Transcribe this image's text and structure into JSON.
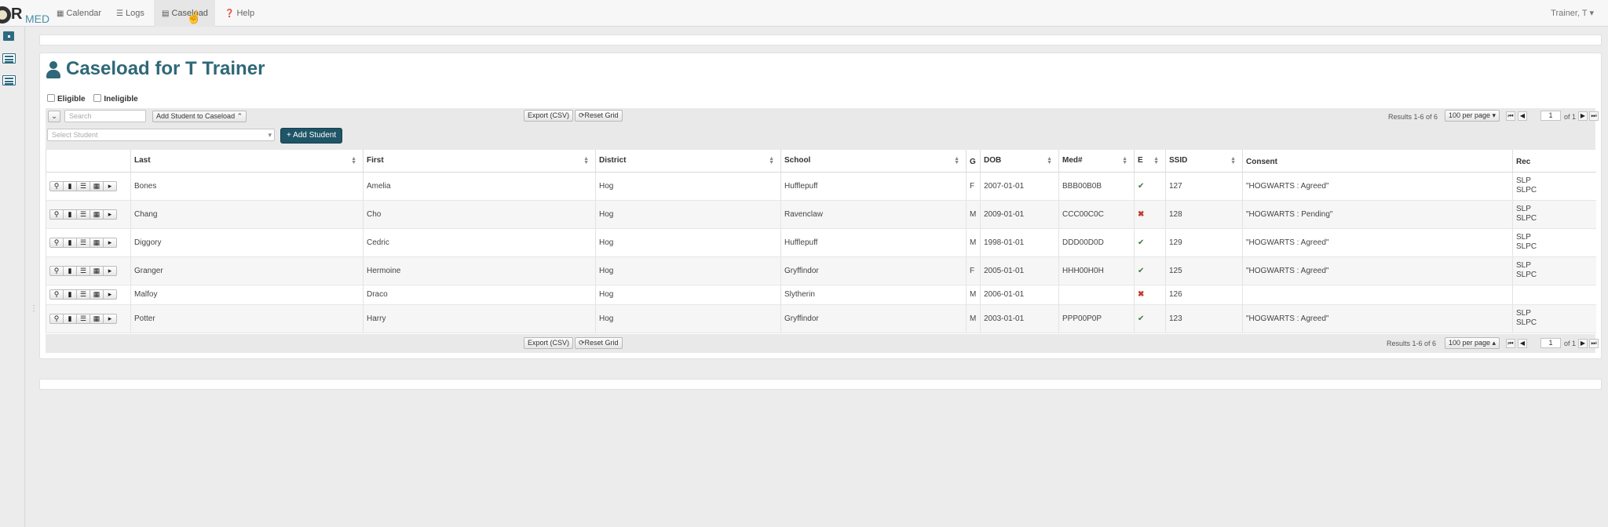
{
  "nav": {
    "logo_r": "R",
    "logo_med": "MED",
    "items": [
      {
        "label": "Calendar",
        "icon": "calendar-icon"
      },
      {
        "label": "Logs",
        "icon": "list-icon"
      },
      {
        "label": "Caseload",
        "icon": "caseload-icon"
      },
      {
        "label": "Help",
        "icon": "help-icon"
      }
    ],
    "user": "Trainer, T ▾"
  },
  "page": {
    "title": "Caseload for T Trainer"
  },
  "filters": {
    "eligible": "Eligible",
    "ineligible": "Ineligible"
  },
  "toolbar": {
    "search_placeholder": "Search",
    "add_to_caseload": "Add Student to Caseload",
    "export": "Export (CSV)",
    "reset": "Reset Grid",
    "select_student_placeholder": "Select Student",
    "add_student": "+ Add Student",
    "results": "Results 1-6 of 6",
    "per_page": "100 per page ▾",
    "per_page_bottom": "100 per page ▴",
    "page_value": "1",
    "of_pages": "of 1"
  },
  "table": {
    "columns": [
      "",
      "Last",
      "First",
      "District",
      "School",
      "G",
      "DOB",
      "Med#",
      "E",
      "SSID",
      "Consent",
      "Rec"
    ],
    "rows": [
      {
        "last": "Bones",
        "first": "Amelia",
        "district": "Hog",
        "school": "Hufflepuff",
        "g": "F",
        "dob": "2007-01-01",
        "med": "BBB00B0B",
        "e": "✔",
        "e_ok": true,
        "ssid": "127",
        "consent": "\"HOGWARTS : Agreed\"",
        "rec1": "SLP",
        "rec2": "SLPC"
      },
      {
        "last": "Chang",
        "first": "Cho",
        "district": "Hog",
        "school": "Ravenclaw",
        "g": "M",
        "dob": "2009-01-01",
        "med": "CCC00C0C",
        "e": "✖",
        "e_ok": false,
        "ssid": "128",
        "consent": "\"HOGWARTS : Pending\"",
        "rec1": "SLP",
        "rec2": "SLPC"
      },
      {
        "last": "Diggory",
        "first": "Cedric",
        "district": "Hog",
        "school": "Hufflepuff",
        "g": "M",
        "dob": "1998-01-01",
        "med": "DDD00D0D",
        "e": "✔",
        "e_ok": true,
        "ssid": "129",
        "consent": "\"HOGWARTS : Agreed\"",
        "rec1": "SLP",
        "rec2": "SLPC"
      },
      {
        "last": "Granger",
        "first": "Hermoine",
        "district": "Hog",
        "school": "Gryffindor",
        "g": "F",
        "dob": "2005-01-01",
        "med": "HHH00H0H",
        "e": "✔",
        "e_ok": true,
        "ssid": "125",
        "consent": "\"HOGWARTS : Agreed\"",
        "rec1": "SLP",
        "rec2": "SLPC"
      },
      {
        "last": "Malfoy",
        "first": "Draco",
        "district": "Hog",
        "school": "Slytherin",
        "g": "M",
        "dob": "2006-01-01",
        "med": "",
        "e": "✖",
        "e_ok": false,
        "ssid": "126",
        "consent": "",
        "rec1": "",
        "rec2": ""
      },
      {
        "last": "Potter",
        "first": "Harry",
        "district": "Hog",
        "school": "Gryffindor",
        "g": "M",
        "dob": "2003-01-01",
        "med": "PPP00P0P",
        "e": "✔",
        "e_ok": true,
        "ssid": "123",
        "consent": "\"HOGWARTS : Agreed\"",
        "rec1": "SLP",
        "rec2": "SLPC"
      }
    ]
  }
}
